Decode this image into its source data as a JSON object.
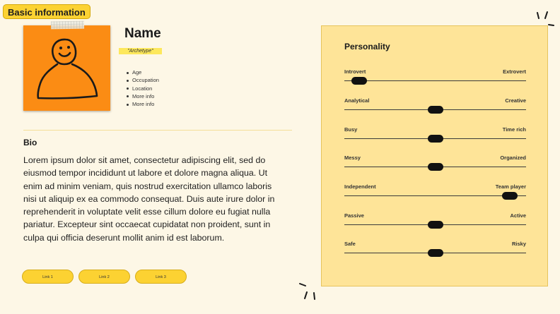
{
  "header": {
    "tag_label": "Basic information"
  },
  "profile": {
    "name": "Name",
    "archetype": "\"Archetype\"",
    "details": [
      "Age",
      "Occupation",
      "Location",
      "More info",
      "More info"
    ]
  },
  "bio": {
    "title": "Bio",
    "text": "Lorem ipsum dolor sit amet, consectetur adipiscing elit, sed do eiusmod tempor incididunt ut labore et dolore magna aliqua. Ut enim ad minim veniam, quis nostrud exercitation ullamco laboris nisi ut aliquip ex ea commodo consequat. Duis aute irure dolor in reprehenderit in voluptate velit esse cillum dolore eu fugiat nulla pariatur. Excepteur sint occaecat cupidatat non proident, sunt in culpa qui officia deserunt mollit anim id est laborum."
  },
  "links": [
    "Link 1",
    "Link 2",
    "Link 3"
  ],
  "personality": {
    "title": "Personality",
    "traits": [
      {
        "left": "Introvert",
        "right": "Extrovert",
        "value": 0.08
      },
      {
        "left": "Analytical",
        "right": "Creative",
        "value": 0.5
      },
      {
        "left": "Busy",
        "right": "Time rich",
        "value": 0.5
      },
      {
        "left": "Messy",
        "right": "Organized",
        "value": 0.5
      },
      {
        "left": "Independent",
        "right": "Team player",
        "value": 0.91
      },
      {
        "left": "Passive",
        "right": "Active",
        "value": 0.5
      },
      {
        "left": "Safe",
        "right": "Risky",
        "value": 0.5
      }
    ]
  },
  "colors": {
    "accent": "#fcd232",
    "photo_bg": "#fb8c14",
    "panel_bg": "#fee498",
    "page_bg": "#fdf7e6"
  }
}
